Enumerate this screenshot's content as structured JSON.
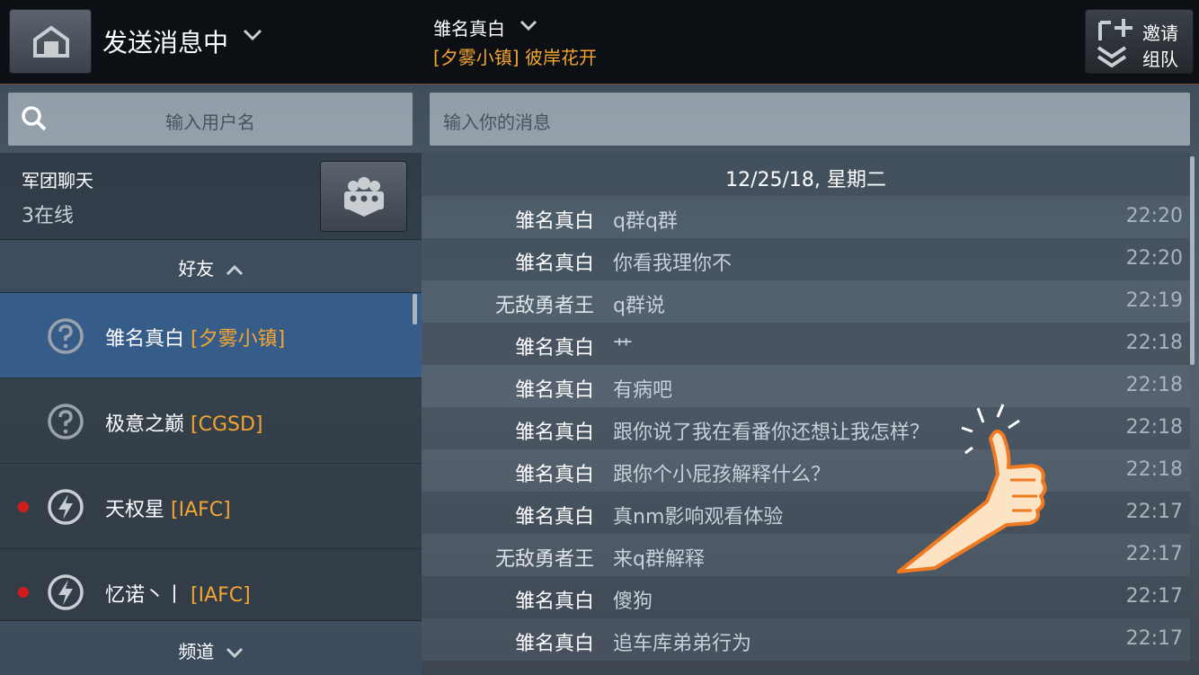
{
  "header": {
    "status": "发送消息中",
    "chat_target": "雏名真白",
    "chat_subtitle": "[夕雾小镇] 彼岸花开",
    "invite_line1": "邀请",
    "invite_line2": "组队"
  },
  "search": {
    "placeholder": "输入用户名"
  },
  "message_input": {
    "placeholder": "输入你的消息"
  },
  "legion": {
    "title": "军团聊天",
    "online": "3在线"
  },
  "friends_header": "好友",
  "channels_header": "频道",
  "friends": [
    {
      "name": "雏名真白",
      "clan": "[夕雾小镇]",
      "icon": "question-icon",
      "online_dot": false,
      "selected": true
    },
    {
      "name": "极意之巅",
      "clan": "[CGSD]",
      "icon": "question-icon",
      "online_dot": false,
      "selected": false
    },
    {
      "name": "天权星",
      "clan": "[IAFC]",
      "icon": "lightning-icon",
      "online_dot": true,
      "selected": false
    },
    {
      "name": "忆诺丶丨",
      "clan": "[IAFC]",
      "icon": "lightning-icon",
      "online_dot": true,
      "selected": false
    }
  ],
  "date_label": "12/25/18, 星期二",
  "messages": [
    {
      "sender": "雏名真白",
      "text": "q群q群",
      "time": "22:20"
    },
    {
      "sender": "雏名真白",
      "text": "你看我理你不",
      "time": "22:20"
    },
    {
      "sender": "无敌勇者王",
      "text": "q群说",
      "time": "22:19"
    },
    {
      "sender": "雏名真白",
      "text": "艹",
      "time": "22:18"
    },
    {
      "sender": "雏名真白",
      "text": "有病吧",
      "time": "22:18"
    },
    {
      "sender": "雏名真白",
      "text": "跟你说了我在看番你还想让我怎样？",
      "time": "22:18"
    },
    {
      "sender": "雏名真白",
      "text": "跟你个小屁孩解释什么？",
      "time": "22:18"
    },
    {
      "sender": "雏名真白",
      "text": "真nm影响观看体验",
      "time": "22:17"
    },
    {
      "sender": "无敌勇者王",
      "text": "来q群解释",
      "time": "22:17"
    },
    {
      "sender": "雏名真白",
      "text": "傻狗",
      "time": "22:17"
    },
    {
      "sender": "雏名真白",
      "text": "追车库弟弟行为",
      "time": "22:17"
    }
  ],
  "colors": {
    "accent_orange": "#f3a531",
    "selected_row": "#365e8f",
    "online_dot": "#d31b1b"
  }
}
